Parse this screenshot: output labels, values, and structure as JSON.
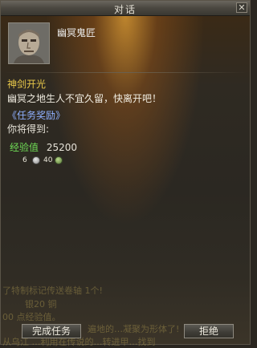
{
  "window": {
    "title": "对话",
    "close_glyph": "✕"
  },
  "npc": {
    "name": "幽冥鬼匠"
  },
  "quest": {
    "name": "神剑开光",
    "dialogue": "幽冥之地生人不宜久留，快离开吧！",
    "reward_header": "《任务奖励》",
    "reward_intro": "你将得到:",
    "exp_label": "经验值",
    "exp_value": "25200",
    "money": {
      "gold": "6",
      "silver": "40"
    }
  },
  "background_text": [
    "了特制标记传送卷轴 1个!",
    "银20 铜",
    "00 点经验值。",
    "遍地的…凝聚为形体了!",
    "从乌江 …利用在传说的…转进甲…找到"
  ],
  "buttons": {
    "complete": "完成任务",
    "reject": "拒绝"
  },
  "colors": {
    "quest_title": "#e8c84a",
    "reward_header": "#8fb0ff",
    "exp_label": "#6fdc56"
  },
  "icons": [
    "close-icon",
    "npc-portrait",
    "silver-coin-icon",
    "green-coin-icon"
  ]
}
